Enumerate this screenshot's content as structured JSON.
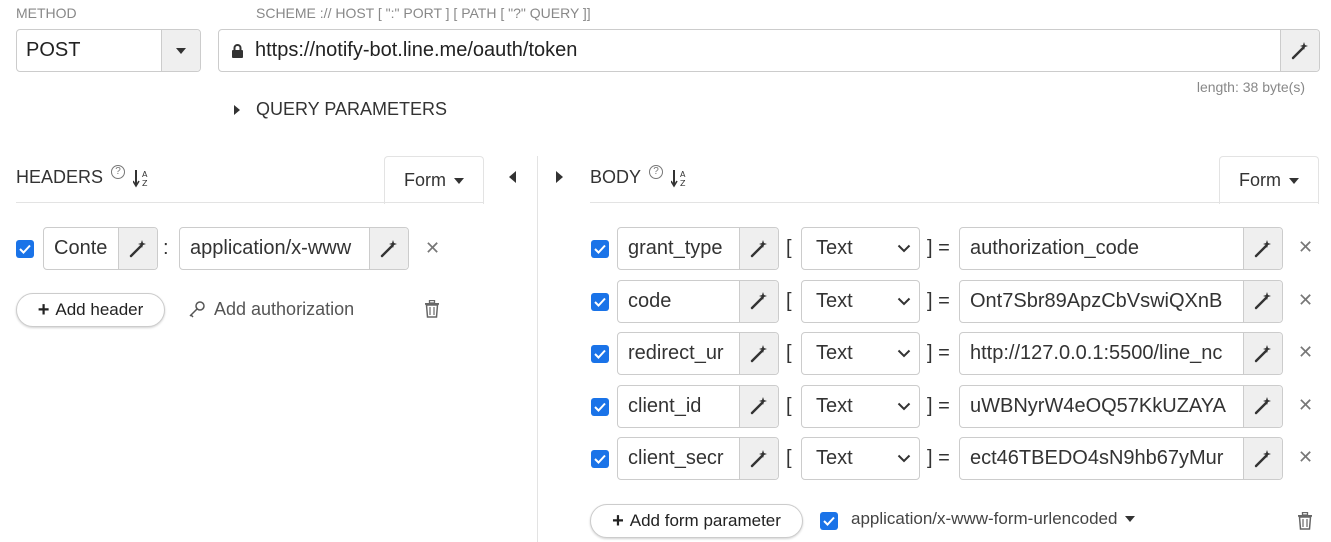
{
  "request": {
    "method_label": "METHOD",
    "method": "POST",
    "url_hint": "SCHEME :// HOST [ \":\" PORT ] [ PATH [ \"?\" QUERY ]]",
    "url": "https://notify-bot.line.me/oauth/token",
    "length": "length: 38 byte(s)",
    "query_params_label": "QUERY PARAMETERS"
  },
  "headers": {
    "title": "HEADERS",
    "mode": "Form",
    "rows": [
      {
        "name": "Conte",
        "value": "application/x-www",
        "checked": true
      }
    ],
    "add_header": "Add header",
    "add_authorization": "Add authorization"
  },
  "body": {
    "title": "BODY",
    "mode": "Form",
    "rows": [
      {
        "name": "grant_type",
        "type": "Text",
        "value": "authorization_code",
        "checked": true
      },
      {
        "name": "code",
        "type": "Text",
        "value": "Ont7Sbr89ApzCbVswiQXnB",
        "checked": true
      },
      {
        "name": "redirect_ur",
        "type": "Text",
        "value": "http://127.0.0.1:5500/line_nc",
        "checked": true
      },
      {
        "name": "client_id",
        "type": "Text",
        "value": "uWBNyrW4eOQ57KkUZAYA",
        "checked": true
      },
      {
        "name": "client_secr",
        "type": "Text",
        "value": "ect46TBEDO4sN9hb67yMur",
        "checked": true
      }
    ],
    "add_form_parameter": "Add form parameter",
    "encoding": "application/x-www-form-urlencoded",
    "open_bracket": "[",
    "close_bracket_eq": "] ="
  },
  "colors": {
    "checkbox": "#1a73e8",
    "border": "#cccccc",
    "button_bg": "#efefef"
  }
}
